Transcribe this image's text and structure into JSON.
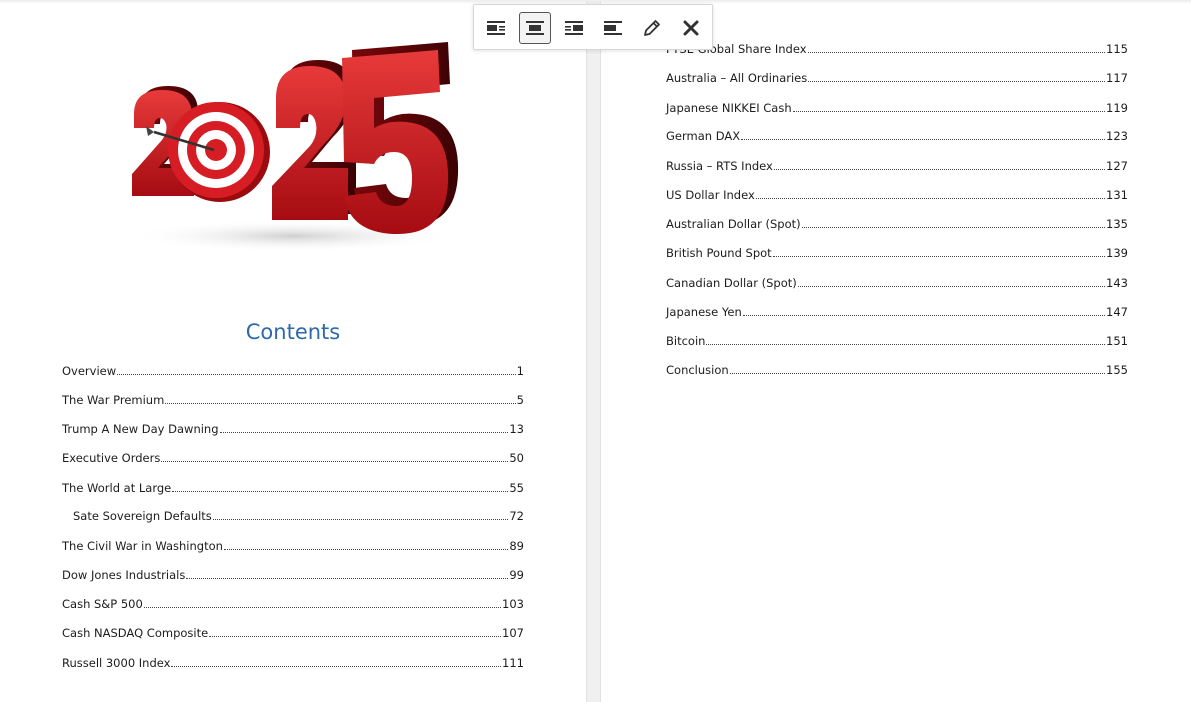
{
  "toolbar": {
    "buttons": [
      {
        "icon": "align-left-wrap-icon",
        "active": false
      },
      {
        "icon": "align-center-icon",
        "active": true
      },
      {
        "icon": "align-right-wrap-icon",
        "active": false
      },
      {
        "icon": "align-inline-icon",
        "active": false
      },
      {
        "icon": "pencil-edit-icon",
        "active": false
      },
      {
        "icon": "close-icon",
        "active": false
      }
    ]
  },
  "hero_image": {
    "text": "2025",
    "icon": "target-dart-icon",
    "color": "#c8141a"
  },
  "contents": {
    "title": "Contents",
    "left_entries": [
      {
        "label": "Overview",
        "page": "1"
      },
      {
        "label": "The War Premium",
        "page": "5"
      },
      {
        "label": "Trump A New Day Dawning",
        "page": "13"
      },
      {
        "label": "Executive Orders",
        "page": "50"
      },
      {
        "label": "The World at Large",
        "page": "55"
      },
      {
        "label": "Sate Sovereign Defaults",
        "page": "72"
      },
      {
        "label": "The Civil War in Washington",
        "page": "89"
      },
      {
        "label": "Dow Jones Industrials",
        "page": "99"
      },
      {
        "label": "Cash S&P 500",
        "page": "103"
      },
      {
        "label": "Cash NASDAQ Composite",
        "page": "107"
      },
      {
        "label": "Russell 3000 Index",
        "page": "111"
      }
    ],
    "right_entries": [
      {
        "label": "FTSE Global Share Index",
        "page": "115"
      },
      {
        "label": "Australia – All Ordinaries",
        "page": "117"
      },
      {
        "label": "Japanese NIKKEI Cash",
        "page": "119"
      },
      {
        "label": "German DAX",
        "page": "123"
      },
      {
        "label": "Russia – RTS Index",
        "page": "127"
      },
      {
        "label": "US Dollar Index",
        "page": "131"
      },
      {
        "label": "Australian Dollar (Spot)",
        "page": "135"
      },
      {
        "label": "British Pound Spot",
        "page": "139"
      },
      {
        "label": "Canadian Dollar (Spot)",
        "page": "143"
      },
      {
        "label": "Japanese Yen",
        "page": "147"
      },
      {
        "label": "Bitcoin",
        "page": "151"
      },
      {
        "label": "Conclusion",
        "page": "155"
      }
    ]
  }
}
